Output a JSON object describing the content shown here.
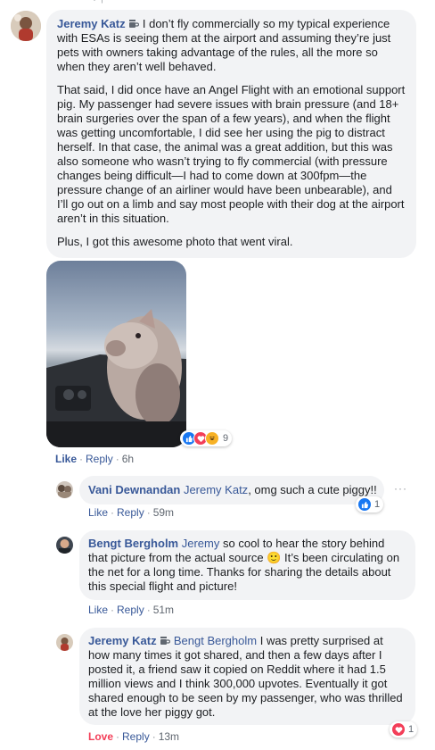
{
  "top_meta": "· ↑",
  "comment1": {
    "author": "Jeremy Katz",
    "paragraphs": [
      "I don’t fly commercially so my typical experience with ESAs is seeing them at the airport and assuming they’re just pets with owners taking advantage of the rules, all the more so when they aren’t well behaved.",
      "That said, I did once have an Angel Flight with an emotional support pig. My passenger had severe issues with brain pressure (and 18+ brain surgeries over the span of a few years), and when the flight was getting uncomfortable, I did see her using the pig to distract herself. In that case, the animal was a great addition, but this was also someone who wasn’t trying to fly commercial (with pressure changes being difficult—I had to come down at 300fpm—the pressure change of an airliner would have been unbearable), and I’ll go out on a limb and say most people with their dog at the airport aren’t in this situation.",
      "Plus, I got this awesome photo that went viral."
    ],
    "reaction_count": "9",
    "like_label": "Like",
    "reply_label": "Reply",
    "time": "6h"
  },
  "reply1": {
    "author": "Vani Dewnandan",
    "mention": "Jeremy Katz",
    "text": ", omg such a cute piggy!!",
    "like_label": "Like",
    "reply_label": "Reply",
    "time": "59m",
    "reaction_count": "1",
    "more_label": "···"
  },
  "reply2": {
    "author": "Bengt Bergholm",
    "mention": "Jeremy",
    "text_before": "so cool to hear the story behind that picture from the actual source",
    "emoji": "🙂",
    "text_after": "It’s been circulating on the net for a long time. Thanks for sharing the details about this special flight and picture!",
    "like_label": "Like",
    "reply_label": "Reply",
    "time": "51m"
  },
  "reply3": {
    "author": "Jeremy Katz",
    "mention": "Bengt Bergholm",
    "text": "I was pretty surprised at how many times it got shared, and then a few days after I posted it, a friend saw it copied on Reddit where it had 1.5 million views and I think 300,000 upvotes. Eventually it got shared enough to be seen by my passenger, who was thrilled at the love her piggy got.",
    "love_label": "Love",
    "reply_label": "Reply",
    "time": "13m",
    "reaction_count": "1"
  },
  "colors": {
    "link": "#385898",
    "bubble": "#f2f3f5",
    "love": "#f33e58",
    "like_blue": "#1877f2"
  }
}
